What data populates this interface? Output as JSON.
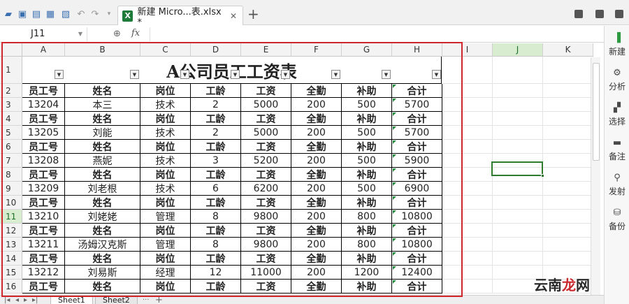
{
  "toolbar": {
    "doc_tab_title": "新建 Micro...表.xlsx *",
    "doc_tab_close": "✕",
    "new_tab": "+"
  },
  "formula_bar": {
    "name_box": "J11",
    "fx": "fx",
    "value": ""
  },
  "columns": [
    "A",
    "B",
    "C",
    "D",
    "E",
    "F",
    "G",
    "H",
    "I",
    "J",
    "K"
  ],
  "active_column": "J",
  "active_row": "11",
  "row_numbers": [
    "1",
    "2",
    "3",
    "4",
    "5",
    "6",
    "7",
    "8",
    "9",
    "10",
    "11",
    "12",
    "13",
    "14",
    "15",
    "16"
  ],
  "table": {
    "title": "A公司员工工资表",
    "headers": [
      "员工号",
      "姓名",
      "岗位",
      "工龄",
      "工资",
      "全勤",
      "补助",
      "合计"
    ],
    "rows": [
      [
        "员工号",
        "姓名",
        "岗位",
        "工龄",
        "工资",
        "全勤",
        "补助",
        "合计"
      ],
      [
        "13204",
        "本三",
        "技术",
        "2",
        "5000",
        "200",
        "500",
        "5700"
      ],
      [
        "员工号",
        "姓名",
        "岗位",
        "工龄",
        "工资",
        "全勤",
        "补助",
        "合计"
      ],
      [
        "13205",
        "刘能",
        "技术",
        "2",
        "5000",
        "200",
        "500",
        "5700"
      ],
      [
        "员工号",
        "姓名",
        "岗位",
        "工龄",
        "工资",
        "全勤",
        "补助",
        "合计"
      ],
      [
        "13208",
        "燕妮",
        "技术",
        "3",
        "5200",
        "200",
        "500",
        "5900"
      ],
      [
        "员工号",
        "姓名",
        "岗位",
        "工龄",
        "工资",
        "全勤",
        "补助",
        "合计"
      ],
      [
        "13209",
        "刘老根",
        "技术",
        "6",
        "6200",
        "200",
        "500",
        "6900"
      ],
      [
        "员工号",
        "姓名",
        "岗位",
        "工龄",
        "工资",
        "全勤",
        "补助",
        "合计"
      ],
      [
        "13210",
        "刘姥姥",
        "管理",
        "8",
        "9800",
        "200",
        "800",
        "10800"
      ],
      [
        "员工号",
        "姓名",
        "岗位",
        "工龄",
        "工资",
        "全勤",
        "补助",
        "合计"
      ],
      [
        "13211",
        "汤姆汉克斯",
        "管理",
        "8",
        "9800",
        "200",
        "800",
        "10800"
      ],
      [
        "员工号",
        "姓名",
        "岗位",
        "工龄",
        "工资",
        "全勤",
        "补助",
        "合计"
      ],
      [
        "13212",
        "刘易斯",
        "经理",
        "12",
        "11000",
        "200",
        "1200",
        "12400"
      ],
      [
        "员工号",
        "姓名",
        "岗位",
        "工龄",
        "工资",
        "全勤",
        "补助",
        "合计"
      ]
    ]
  },
  "right_panel": [
    {
      "label": "新建",
      "icon": "new-icon"
    },
    {
      "label": "分析",
      "icon": "analysis-icon"
    },
    {
      "label": "选择",
      "icon": "select-icon"
    },
    {
      "label": "备注",
      "icon": "comment-icon"
    },
    {
      "label": "发射",
      "icon": "share-icon"
    },
    {
      "label": "备份",
      "icon": "backup-icon"
    }
  ],
  "sheet_tabs": [
    "Sheet1",
    "Sheet2"
  ],
  "sheet_tab_more": "···",
  "sheet_tab_add": "+",
  "watermark": {
    "prefix": "云南",
    "highlight": "龙",
    "suffix": "网"
  },
  "colors": {
    "frame_red": "#d1262c",
    "selection_green": "#2f7b2f",
    "excel_green": "#1e7b3a"
  }
}
